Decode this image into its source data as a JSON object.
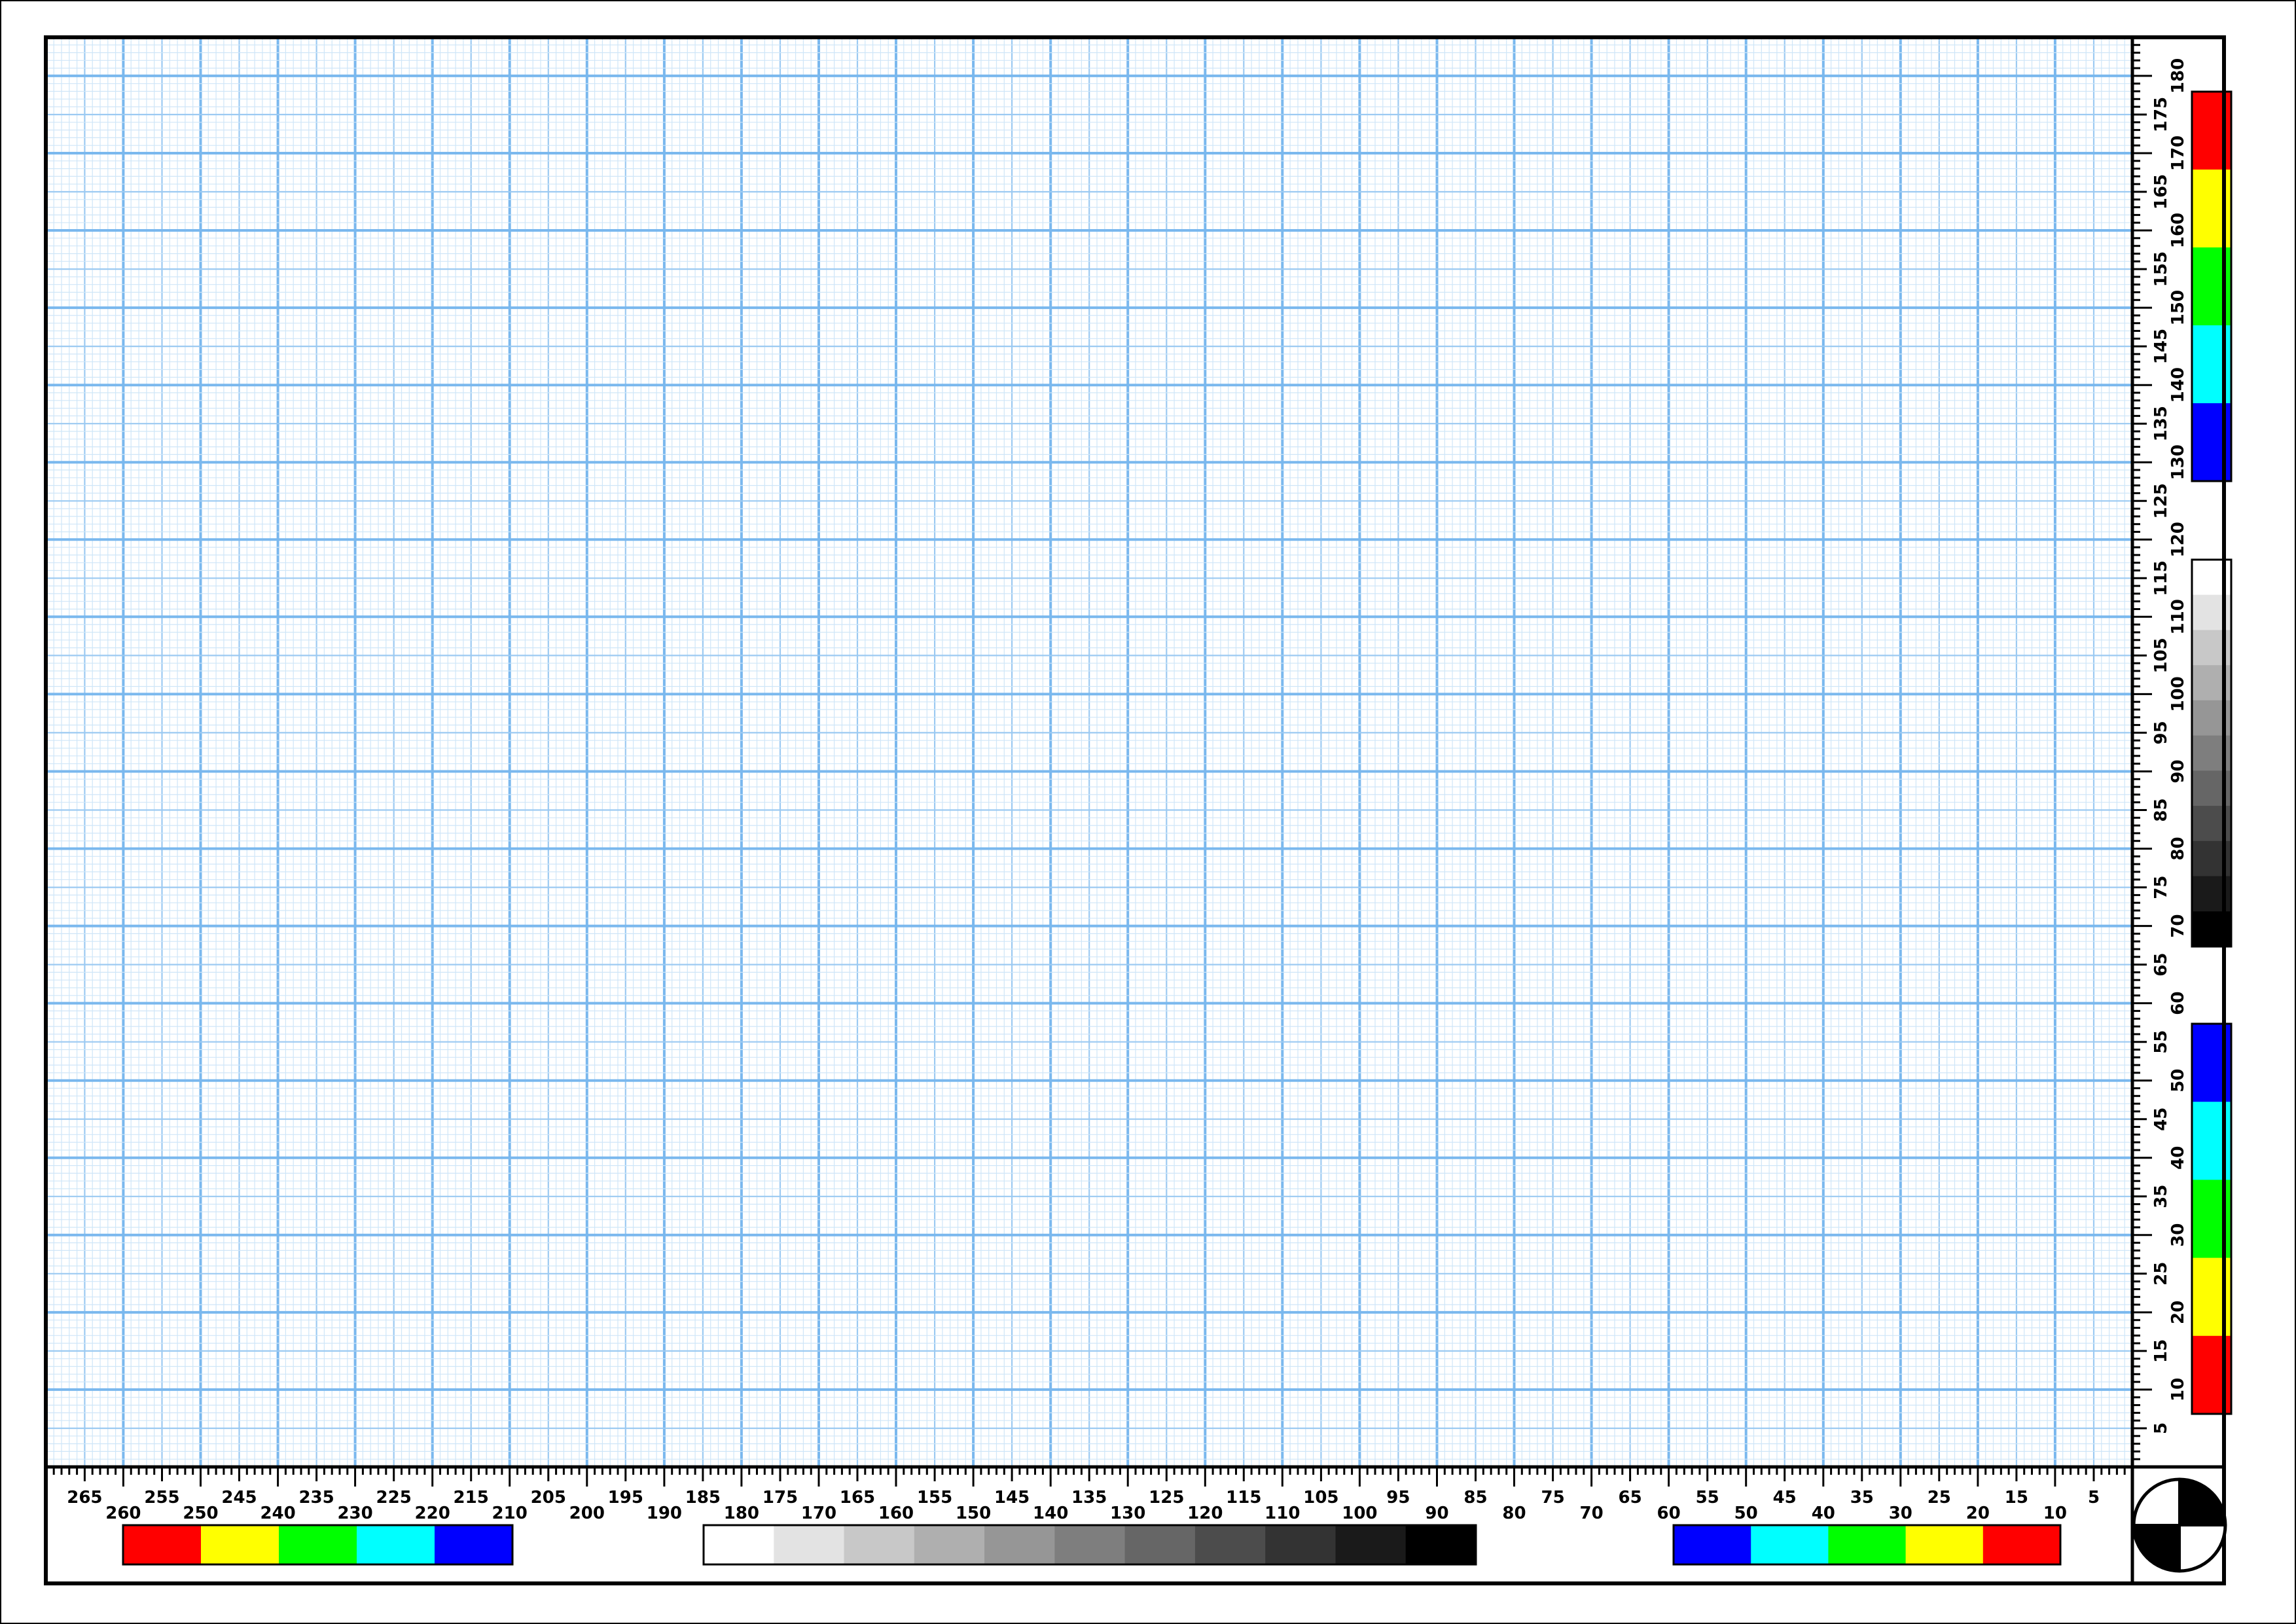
{
  "sheet": {
    "grid_color_major": "#7ab8ee",
    "grid_color_minor": "#cfe6f8",
    "border_color": "#000000"
  },
  "bottom_ruler": {
    "upper_row": [
      "265",
      "255",
      "245",
      "235",
      "225",
      "215",
      "205",
      "195",
      "185",
      "175",
      "165",
      "155",
      "145",
      "135",
      "125",
      "115",
      "105",
      "95",
      "85",
      "75",
      "65",
      "55",
      "45",
      "35",
      "25",
      "15",
      "5"
    ],
    "lower_row": [
      "260",
      "250",
      "240",
      "230",
      "220",
      "210",
      "200",
      "190",
      "180",
      "170",
      "160",
      "150",
      "140",
      "130",
      "120",
      "110",
      "100",
      "90",
      "80",
      "70",
      "60",
      "50",
      "40",
      "30",
      "20",
      "10"
    ]
  },
  "right_ruler": {
    "upper_col": [
      "180",
      "170",
      "160",
      "150",
      "140",
      "130",
      "120",
      "110",
      "100",
      "90",
      "80",
      "70",
      "60",
      "50",
      "40",
      "30",
      "20",
      "10"
    ],
    "lower_col": [
      "175",
      "165",
      "155",
      "145",
      "135",
      "125",
      "115",
      "105",
      "95",
      "85",
      "75",
      "65",
      "55",
      "45",
      "35",
      "25",
      "15",
      "5"
    ]
  },
  "color_bars": {
    "bottom_left": [
      "#ff0000",
      "#ffff00",
      "#00ff00",
      "#00ffff",
      "#0000ff"
    ],
    "bottom_gray": [
      "#ffffff",
      "#e3e3e3",
      "#c8c8c8",
      "#afafaf",
      "#969696",
      "#7e7e7e",
      "#666666",
      "#4c4c4c",
      "#333333",
      "#1a1a1a",
      "#000000"
    ],
    "bottom_right": [
      "#0000ff",
      "#00ffff",
      "#00ff00",
      "#ffff00",
      "#ff0000"
    ],
    "right_top": [
      "#ff0000",
      "#ffff00",
      "#00ff00",
      "#00ffff",
      "#0000ff"
    ],
    "right_gray": [
      "#ffffff",
      "#e3e3e3",
      "#c8c8c8",
      "#afafaf",
      "#969696",
      "#7e7e7e",
      "#666666",
      "#4c4c4c",
      "#333333",
      "#1a1a1a",
      "#000000"
    ],
    "right_bottom": [
      "#0000ff",
      "#00ffff",
      "#00ff00",
      "#ffff00",
      "#ff0000"
    ]
  },
  "registration_mark": {
    "icon": "crosshair-target-icon"
  }
}
